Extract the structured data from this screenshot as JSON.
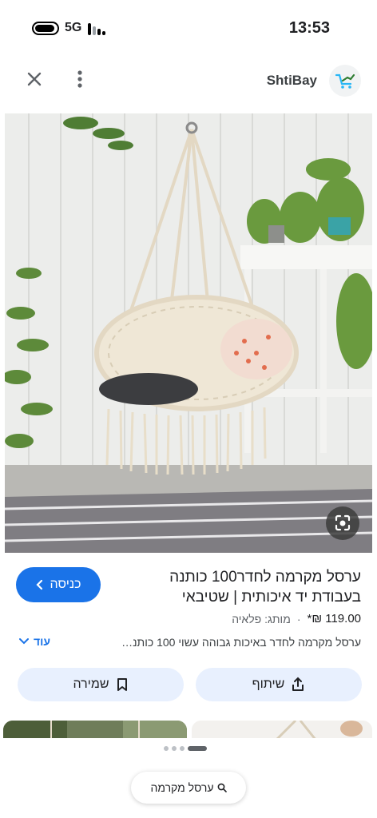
{
  "status_bar": {
    "network": "5G",
    "time": "13:53"
  },
  "appbar": {
    "site_name": "ShtiBay",
    "close_icon": "close-icon",
    "more_icon": "more-vert-icon",
    "logo_icon": "shopping-cart-logo-icon"
  },
  "hero": {
    "lens_icon": "google-lens-icon"
  },
  "product": {
    "title": "ערסל מקרמה לחדר100 כותנה בעבודת יד איכותית | שטיבאי",
    "price": "119.00 ₪*",
    "brand": "מותג: פלאיה",
    "description": "ערסל מקרמה לחדר באיכות גבוהה עשוי 100 כותנה...",
    "more_label": "עוד",
    "enter_label": "כניסה"
  },
  "actions": {
    "share_label": "שיתוף",
    "save_label": "שמירה"
  },
  "pager": {
    "count": 4,
    "active": 3
  },
  "search_chip": {
    "label": "ערסל מקרמה"
  },
  "colors": {
    "accent": "#1a73e8",
    "pill_bg": "#e8f0fe"
  }
}
